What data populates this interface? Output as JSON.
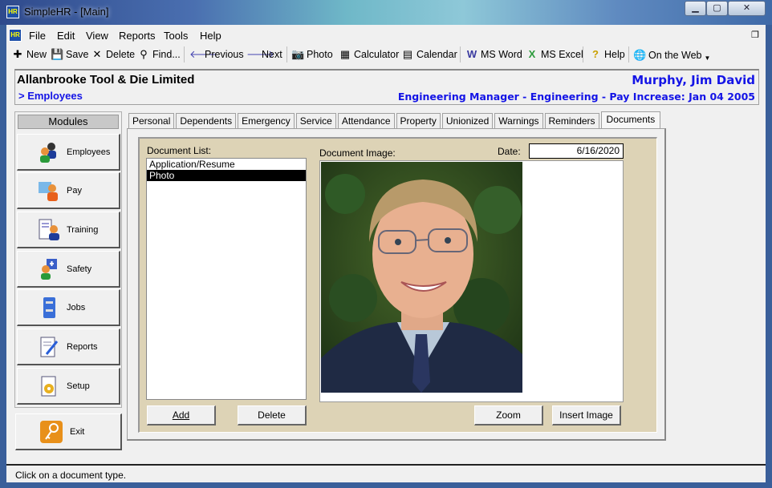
{
  "window": {
    "title": "SimpleHR - [Main]",
    "app_icon": "HR",
    "minimize": "▁",
    "maximize": "▢",
    "close": "✕"
  },
  "menu": [
    "File",
    "Edit",
    "View",
    "Reports",
    "Tools",
    "Help"
  ],
  "toolbar": {
    "new": "New",
    "save": "Save",
    "delete": "Delete",
    "find": "Find...",
    "previous": "Previous",
    "next": "Next",
    "photo": "Photo",
    "calculator": "Calculator",
    "calendar": "Calendar",
    "msword": "MS Word",
    "msexcel": "MS Excel",
    "help": "Help",
    "web": "On the Web"
  },
  "header": {
    "company": "Allanbrooke Tool & Die Limited",
    "breadcrumb": "> Employees",
    "employee_name": "Murphy, Jim David",
    "employee_info": "Engineering Manager - Engineering - Pay Increase: Jan 04 2005"
  },
  "modules": {
    "title": "Modules",
    "items": [
      "Employees",
      "Pay",
      "Training",
      "Safety",
      "Jobs",
      "Reports",
      "Setup"
    ],
    "exit": "Exit"
  },
  "tabs": [
    "Personal",
    "Dependents",
    "Emergency",
    "Service",
    "Attendance",
    "Property",
    "Unionized",
    "Warnings",
    "Reminders",
    "Documents"
  ],
  "active_tab": "Documents",
  "documents": {
    "list_label": "Document List:",
    "items": [
      "Application/Resume",
      "Photo"
    ],
    "selected": "Photo",
    "image_label": "Document Image:",
    "date_label": "Date:",
    "date": "6/16/2020",
    "add": "Add",
    "delete": "Delete",
    "zoom": "Zoom",
    "insert": "Insert Image"
  },
  "status": "Click on a document type.",
  "colors": {
    "accent_blue": "#1414e6",
    "panel_tan": "#ddd3b6"
  }
}
